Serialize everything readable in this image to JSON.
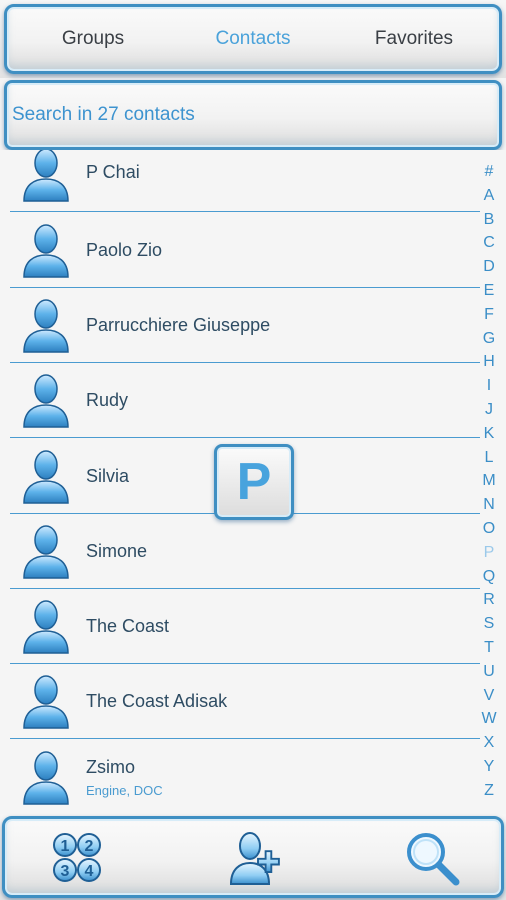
{
  "tabs": [
    {
      "label": "Groups"
    },
    {
      "label": "Contacts"
    },
    {
      "label": "Favorites"
    }
  ],
  "active_tab": "Contacts",
  "search": {
    "placeholder": "Search in 27 contacts"
  },
  "contacts": [
    {
      "name": "P Chai"
    },
    {
      "name": "Paolo Zio"
    },
    {
      "name": "Parrucchiere Giuseppe"
    },
    {
      "name": "Rudy"
    },
    {
      "name": "Silvia"
    },
    {
      "name": "Simone"
    },
    {
      "name": "The Coast"
    },
    {
      "name": "The Coast Adisak"
    },
    {
      "name": "Zsimo",
      "subtitle": "Engine, DOC"
    }
  ],
  "alphabet": [
    "#",
    "A",
    "B",
    "C",
    "D",
    "E",
    "F",
    "G",
    "H",
    "I",
    "J",
    "K",
    "L",
    "M",
    "N",
    "O",
    "P",
    "Q",
    "R",
    "S",
    "T",
    "U",
    "V",
    "W",
    "X",
    "Y",
    "Z"
  ],
  "alphabet_active": "P",
  "letter_overlay": "P",
  "toolbar": {
    "dialer_icon": "dialpad-1234-icon",
    "add_icon": "add-contact-icon",
    "search_icon": "magnifier-icon"
  },
  "colors": {
    "accent": "#4aa2da",
    "frame": "#3f8fc2",
    "text": "#2e4c63"
  }
}
